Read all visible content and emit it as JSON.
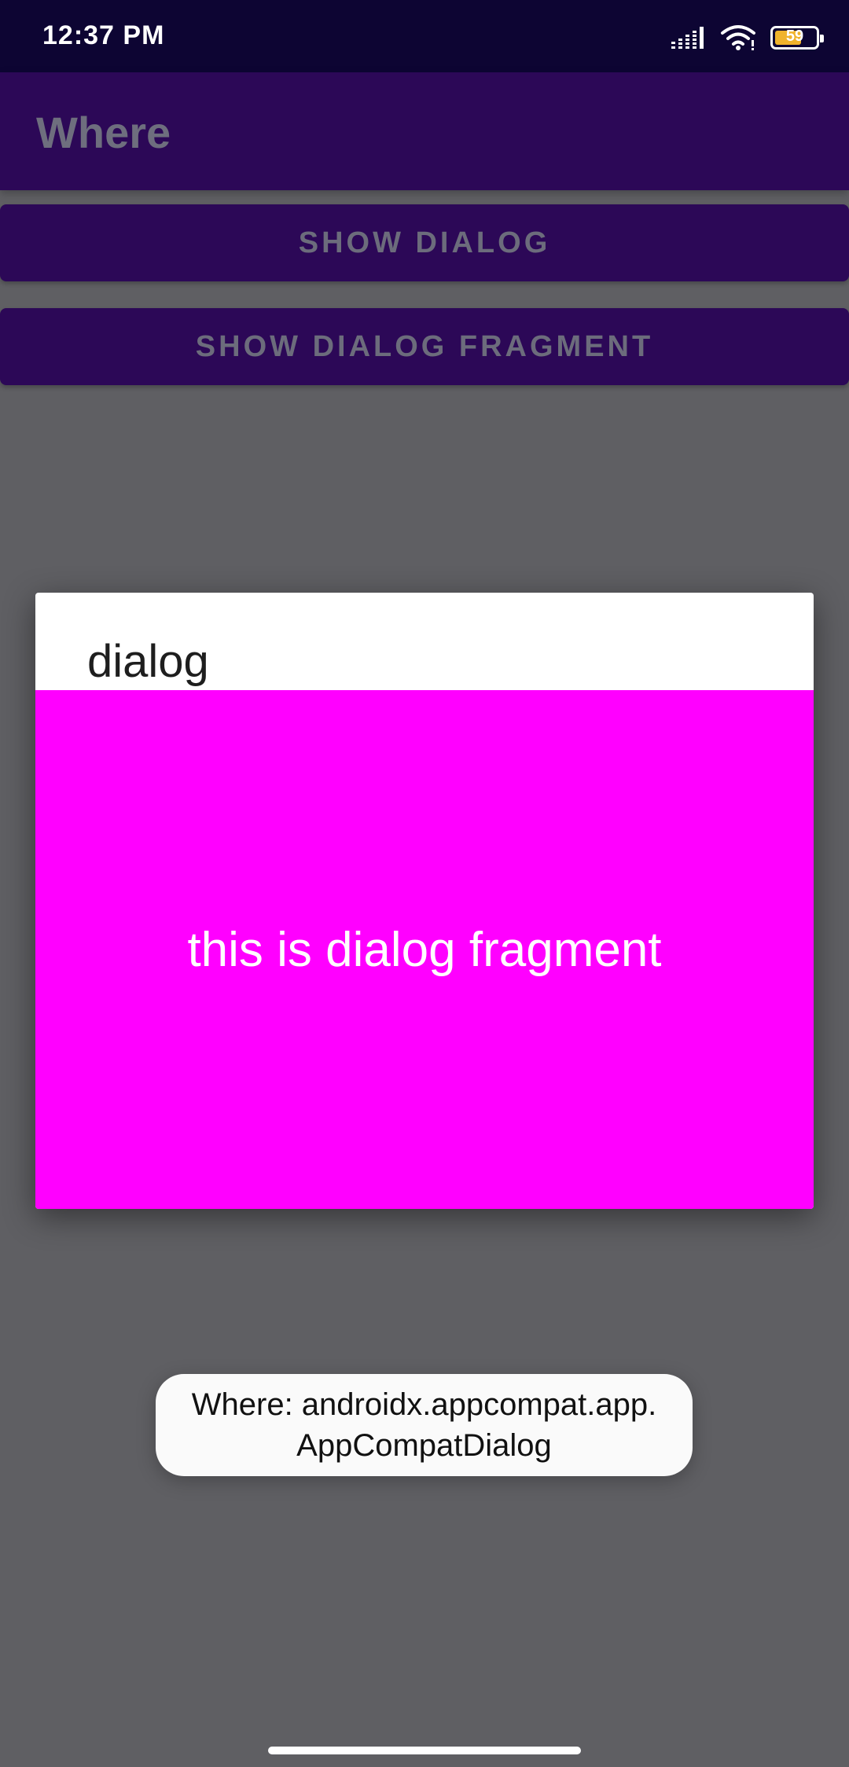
{
  "status_bar": {
    "time": "12:37 PM",
    "battery_level": "59",
    "icons": [
      "signal-icon",
      "wifi-icon",
      "battery-icon"
    ]
  },
  "app_bar": {
    "title": "Where"
  },
  "buttons": {
    "show_dialog": "SHOW DIALOG",
    "show_dialog_fragment": "SHOW DIALOG FRAGMENT"
  },
  "dialog": {
    "title": "dialog",
    "content": "this is dialog fragment",
    "content_color": "#ff00ff"
  },
  "toast": {
    "text": "Where: androidx.appcompat.app.AppCompatDialog"
  },
  "colors": {
    "primary_dark": "#0d0533",
    "primary": "#2c0857",
    "scrim": "#5f5f63",
    "battery": "#f0b32c"
  }
}
